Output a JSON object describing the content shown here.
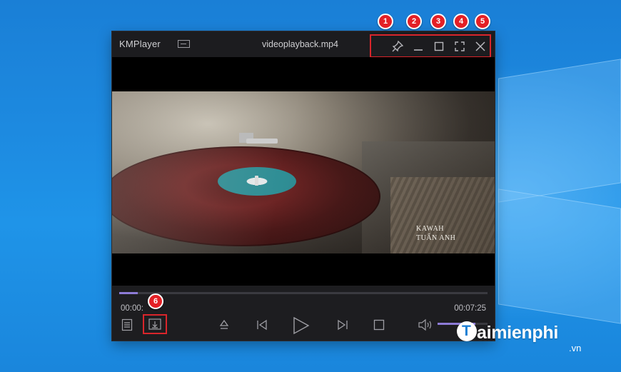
{
  "window": {
    "app_name": "KMPlayer",
    "file_name": "videoplayback.mp4"
  },
  "title_buttons": [
    {
      "name": "pin",
      "icon": "pin-icon"
    },
    {
      "name": "minimize",
      "icon": "minimize-icon"
    },
    {
      "name": "maximize",
      "icon": "maximize-icon"
    },
    {
      "name": "fullscreen",
      "icon": "fullscreen-icon"
    },
    {
      "name": "close",
      "icon": "close-icon"
    }
  ],
  "video": {
    "credit_line_1": "KAWAH",
    "credit_line_2": "TUẤN ANH"
  },
  "playback": {
    "current_time": "00:00:",
    "total_time": "00:07:25",
    "progress_fraction": 0.05,
    "volume_fraction": 0.75
  },
  "callouts": [
    "1",
    "2",
    "3",
    "4",
    "5",
    "6"
  ],
  "watermark": {
    "brand": "aimienphi",
    "domain": ".vn"
  },
  "colors": {
    "accent": "#8d7bd6",
    "highlight_box": "#d9252b",
    "badge": "#e42026",
    "desktop_blue": "#1d8ae0"
  }
}
